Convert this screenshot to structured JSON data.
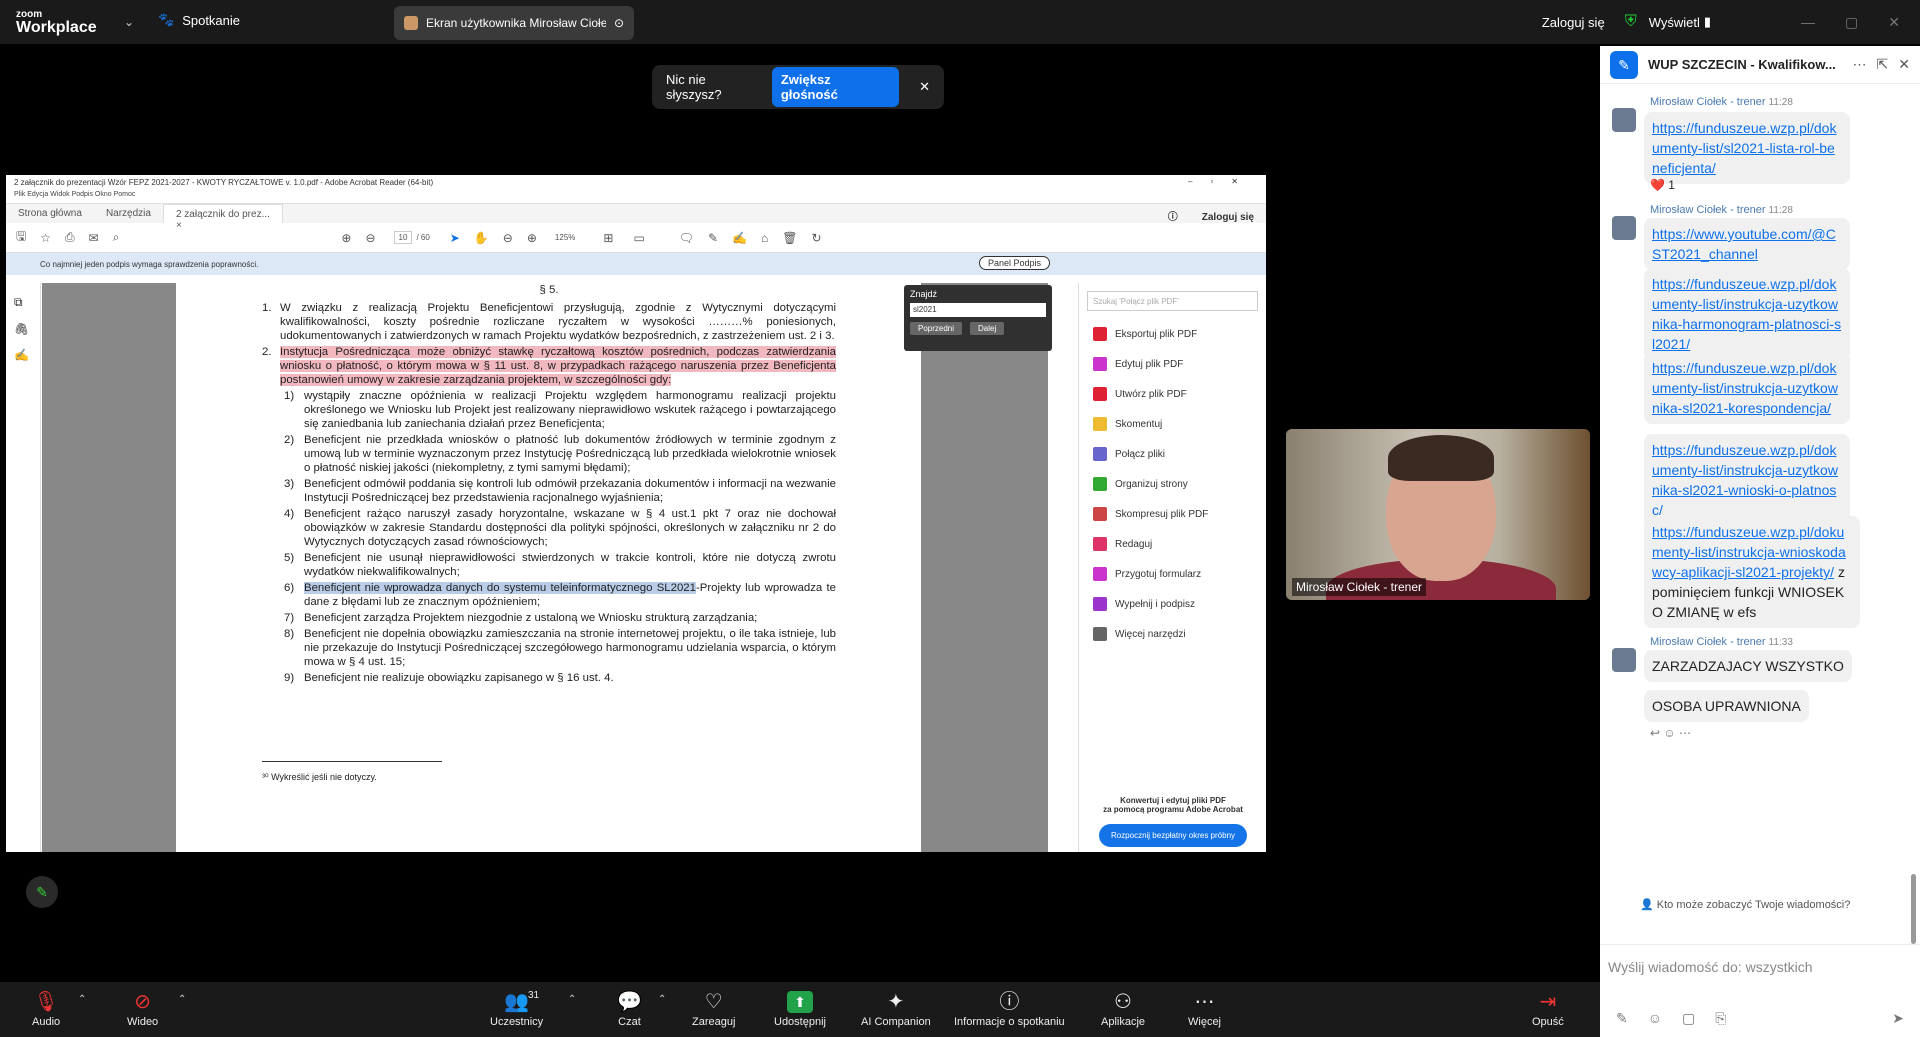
{
  "topbar": {
    "logo_small": "zoom",
    "logo_main": "Workplace",
    "meeting_label": "Spotkanie",
    "screen_share_label": "Ekran użytkownika Mirosław Ciołek",
    "login": "Zaloguj się",
    "view": "Wyświetl"
  },
  "notice": {
    "text": "Nic nie słyszysz?",
    "button": "Zwiększ głośność"
  },
  "acrobat": {
    "title": "2 załącznik do prezentacji Wzór FEPZ 2021-2027 - KWOTY RYCZAŁTOWE v. 1.0.pdf - Adobe Acrobat Reader (64-bit)",
    "menus": "Plik   Edycja   Widok   Podpis   Okno   Pomoc",
    "tab_home": "Strona główna",
    "tab_tools": "Narzędzia",
    "tab_doc": "2 załącznik do prez...",
    "login": "Zaloguj się",
    "page_current": "10",
    "page_total": "/ 60",
    "zoom": "125%",
    "info": "Co najmniej jeden podpis wymaga sprawdzenia poprawności.",
    "sign_panel": "Panel Podpis",
    "section": "§ 5.",
    "item1": "W związku z realizacją Projektu Beneficjentowi przysługują, zgodnie z Wytycznymi dotyczącymi kwalifikowalności, koszty pośrednie rozliczane ryczałtem w wysokości ………% poniesionych, udokumentowanych i zatwierdzonych w ramach Projektu wydatków bezpośrednich, z zastrzeżeniem ust. 2 i 3.",
    "item2": "Instytucja Pośrednicząca może obniżyć stawkę ryczałtową kosztów pośrednich, podczas zatwierdzania wniosku o płatność, o którym mowa w § 11 ust. 8, w przypadkach rażącego naruszenia przez Beneficjenta postanowień umowy w zakresie zarządzania projektem, w szczególności gdy:",
    "subs": [
      {
        "n": "1)",
        "t": "wystąpiły znaczne opóźnienia w realizacji Projektu względem harmonogramu realizacji projektu określonego we Wniosku lub Projekt jest realizowany nieprawidłowo wskutek rażącego i powtarzającego się zaniedbania lub zaniechania działań przez Beneficjenta;"
      },
      {
        "n": "2)",
        "t": "Beneficjent nie przedkłada wniosków o płatność lub dokumentów źródłowych w terminie zgodnym z umową lub w terminie wyznaczonym przez Instytucję Pośredniczącą lub przedkłada wielokrotnie wniosek o płatność niskiej jakości (niekompletny, z tymi samymi błędami);"
      },
      {
        "n": "3)",
        "t": "Beneficjent odmówił poddania się kontroli lub odmówił przekazania dokumentów i informacji na wezwanie Instytucji Pośredniczącej bez przedstawienia racjonalnego wyjaśnienia;"
      },
      {
        "n": "4)",
        "t": "Beneficjent rażąco naruszył zasady horyzontalne, wskazane w § 4 ust.1 pkt 7 oraz nie dochował obowiązków w zakresie Standardu dostępności dla polityki spójności, określonych w załączniku nr 2 do Wytycznych dotyczących zasad równościowych;"
      },
      {
        "n": "5)",
        "t": "Beneficjent nie usunął nieprawidłowości stwierdzonych w trakcie kontroli, które nie dotyczą zwrotu wydatków niekwalifikowalnych;"
      },
      {
        "n": "6)",
        "t_hl": "Beneficjent nie wprowadza danych do systemu teleinformatycznego SL2021",
        "t": "-Projekty lub wprowadza te dane z błędami lub ze znacznym opóźnieniem;"
      },
      {
        "n": "7)",
        "t": "Beneficjent zarządza Projektem niezgodnie z ustaloną we Wniosku strukturą zarządzania;"
      },
      {
        "n": "8)",
        "t": "Beneficjent nie dopełnia obowiązku zamieszczania na stronie internetowej projektu, o ile taka istnieje, lub nie przekazuje do Instytucji Pośredniczącej szczegółowego harmonogramu udzielania wsparcia, o którym mowa w § 4 ust. 15;"
      },
      {
        "n": "9)",
        "t": "Beneficjent nie realizuje obowiązku zapisanego w § 16 ust. 4."
      }
    ],
    "footnote": "³⁰ Wykreślić jeśli nie dotyczy.",
    "find_title": "Znajdź",
    "find_value": "sl2021",
    "find_prev": "Poprzedni",
    "find_next": "Dalej",
    "panel_search": "Szukaj 'Połącz plik PDF'",
    "panel_tools": [
      {
        "label": "Eksportuj plik PDF",
        "color": "#d23"
      },
      {
        "label": "Edytuj plik PDF",
        "color": "#c3c"
      },
      {
        "label": "Utwórz plik PDF",
        "color": "#d23"
      },
      {
        "label": "Skomentuj",
        "color": "#eb3"
      },
      {
        "label": "Połącz pliki",
        "color": "#66c"
      },
      {
        "label": "Organizuj strony",
        "color": "#3a3"
      },
      {
        "label": "Skompresuj plik PDF",
        "color": "#c44"
      },
      {
        "label": "Redaguj",
        "color": "#d36"
      },
      {
        "label": "Przygotuj formularz",
        "color": "#c3c"
      },
      {
        "label": "Wypełnij i podpisz",
        "color": "#93c"
      },
      {
        "label": "Więcej narzędzi",
        "color": "#666"
      }
    ],
    "promo_line1": "Konwertuj i edytuj pliki PDF",
    "promo_line2": "za pomocą programu Adobe Acrobat",
    "promo_button": "Rozpocznij bezpłatny okres próbny"
  },
  "video": {
    "name": "Mirosław Ciołek - trener"
  },
  "bottombar": {
    "audio": "Audio",
    "video": "Wideo",
    "participants": "Uczestnicy",
    "participants_count": "31",
    "chat": "Czat",
    "react": "Zareaguj",
    "share": "Udostępnij",
    "ai": "AI Companion",
    "info": "Informacje o spotkaniu",
    "apps": "Aplikacje",
    "more": "Więcej",
    "leave": "Opuść"
  },
  "chat": {
    "title": "WUP SZCZECIN - Kwalifikow...",
    "sender": "Mirosław Ciołek - trener",
    "time1": "11:28",
    "time2": "11:28",
    "time3": "11:33",
    "link1": "https://funduszeue.wzp.pl/dokumenty-list/sl2021-lista-rol-beneficjenta/",
    "reaction": "❤️ 1",
    "link2": "https://www.youtube.com/@CST2021_channel",
    "link3": "https://funduszeue.wzp.pl/dokumenty-list/instrukcja-uzytkownika-harmonogram-platnosci-sl2021/",
    "link4": "https://funduszeue.wzp.pl/dokumenty-list/instrukcja-uzytkownika-sl2021-korespondencja/",
    "link5": "https://funduszeue.wzp.pl/dokumenty-list/instrukcja-uzytkownika-sl2021-wnioski-o-platnosc/",
    "link6": "https://funduszeue.wzp.pl/dokumenty-list/instrukcja-wnioskodawcy-aplikacji-sl2021-projekty/",
    "link6_suffix": " z pominięciem funkcji WNIOSEK O ZMIANĘ w efs",
    "msg_a": "ZARZADZAJACY WSZYSTKO",
    "msg_b": "OSOBA UPRAWNIONA",
    "who_sees": "Kto może zobaczyć Twoje wiadomości?",
    "input_placeholder": "Wyślij wiadomość do: wszystkich"
  }
}
